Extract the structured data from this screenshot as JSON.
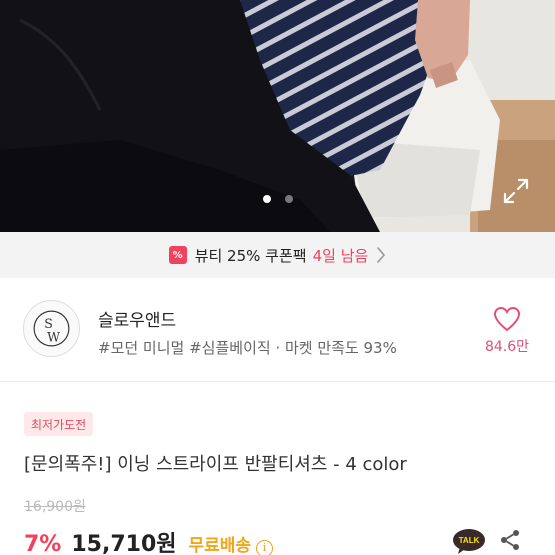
{
  "hero": {
    "dots_total": 2,
    "dots_active": 0,
    "expand_icon": "expand-icon"
  },
  "coupon": {
    "badge_icon": "coupon-icon",
    "badge_glyph": "%",
    "text": "뷰티 25% 쿠폰팩",
    "remain": "4일 남음",
    "chevron_icon": "chevron-right-icon"
  },
  "shop": {
    "name": "슬로우앤드",
    "tags": "#모던 미니멀 #심플베이직 · 마켓 만족도 93%",
    "like_count": "84.6만",
    "like_icon": "heart-icon"
  },
  "product": {
    "badge": "최저가도전",
    "title": "[문의폭주!] 이닝 스트라이프 반팔티셔츠  - 4 color",
    "original_price": "16,900원",
    "discount": "7%",
    "price": "15,710원",
    "shipping": "무료배송",
    "info_glyph": "i",
    "talk_icon": "kakaotalk-icon",
    "talk_label": "TALK",
    "share_icon": "share-icon"
  },
  "colors": {
    "accent_pink": "#f0425c",
    "shipping_orange": "#f2a516",
    "like_pink": "#e0507a"
  }
}
